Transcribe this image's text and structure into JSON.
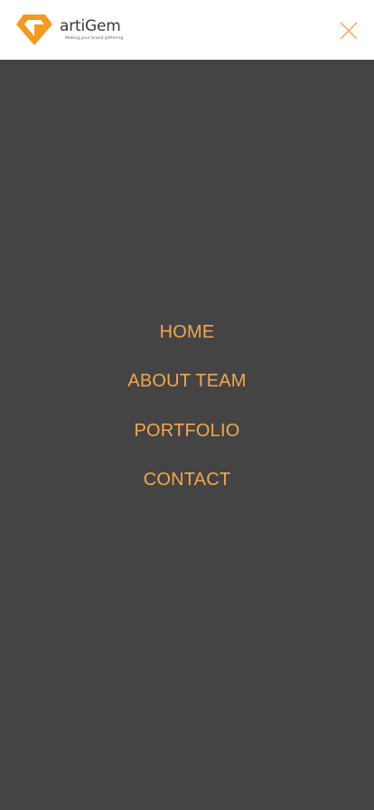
{
  "header": {
    "brand_name": "artiGem",
    "brand_tagline": "Making your brand glittering",
    "logo_icon": "gem-logo-icon",
    "close_icon": "close-icon"
  },
  "menu": {
    "items": [
      {
        "label": "HOME"
      },
      {
        "label": "ABOUT TEAM"
      },
      {
        "label": "PORTFOLIO"
      },
      {
        "label": "CONTACT"
      }
    ]
  },
  "colors": {
    "header_bg": "#ffffff",
    "overlay_bg": "#444444",
    "accent": "#f5a64a",
    "logo_orange": "#f39a1f"
  }
}
